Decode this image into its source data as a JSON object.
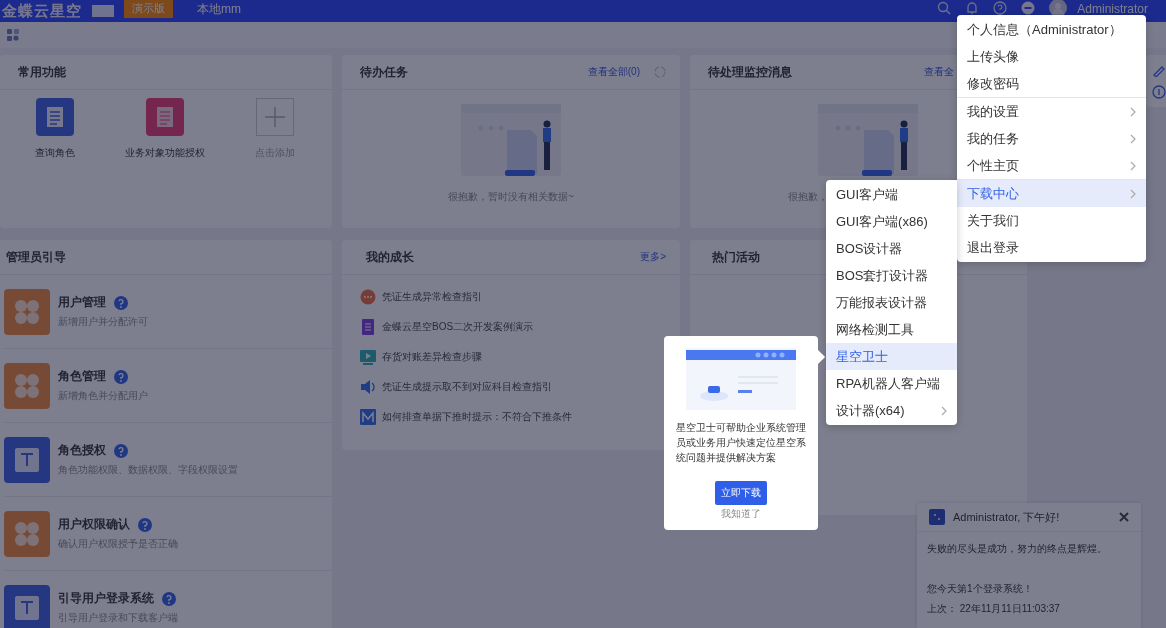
{
  "header": {
    "logo": "金蝶云星空",
    "demo_badge": "演示版",
    "org": "本地mm",
    "user": "Administrator"
  },
  "common_functions": {
    "title": "常用功能",
    "items": [
      {
        "label": "查询角色",
        "kind": "list"
      },
      {
        "label": "业务对象功能授权",
        "kind": "doc"
      },
      {
        "label": "点击添加",
        "kind": "add"
      }
    ]
  },
  "todo": {
    "title": "待办任务",
    "link": "查看全部(0)",
    "empty": "很抱歉，暂时没有相关数据~"
  },
  "monitor": {
    "title": "待处理监控消息",
    "link": "查看全",
    "empty": "很抱歉，"
  },
  "admin_guide": {
    "title": "管理员引导",
    "items": [
      {
        "title": "用户管理",
        "desc": "新增用户并分配许可",
        "kind": "clover"
      },
      {
        "title": "角色管理",
        "desc": "新增角色并分配用户",
        "kind": "clover"
      },
      {
        "title": "角色授权",
        "desc": "角色功能权限、数据权限、字段权限设置",
        "kind": "text"
      },
      {
        "title": "用户权限确认",
        "desc": "确认用户权限授予是否正确",
        "kind": "clover"
      },
      {
        "title": "引导用户登录系统",
        "desc": "引导用户登录和下载客户端",
        "kind": "text"
      }
    ]
  },
  "growth": {
    "title": "我的成长",
    "link": "更多>",
    "items": [
      {
        "text": "凭证生成异常检查指引",
        "kind": "chat"
      },
      {
        "text": "金蝶云星空BOS二次开发案例演示",
        "kind": "doc"
      },
      {
        "text": "存货对账差异检查步骤",
        "kind": "video"
      },
      {
        "text": "凭证生成提示取不到对应科目检查指引",
        "kind": "audio"
      },
      {
        "text": "如何排查单据下推时提示：不符合下推条件",
        "kind": "chart"
      }
    ]
  },
  "hot": {
    "title": "热门活动"
  },
  "user_menu": {
    "items": [
      {
        "label": "个人信息（Administrator）",
        "submenu": false,
        "selected": false,
        "divider_after": false
      },
      {
        "label": "上传头像",
        "submenu": false,
        "selected": false,
        "divider_after": false
      },
      {
        "label": "修改密码",
        "submenu": false,
        "selected": false,
        "divider_after": true
      },
      {
        "label": "我的设置",
        "submenu": true,
        "selected": false,
        "divider_after": false
      },
      {
        "label": "我的任务",
        "submenu": true,
        "selected": false,
        "divider_after": false
      },
      {
        "label": "个性主页",
        "submenu": true,
        "selected": false,
        "divider_after": true
      },
      {
        "label": "下载中心",
        "submenu": true,
        "selected": true,
        "divider_after": false
      },
      {
        "label": "关于我们",
        "submenu": false,
        "selected": false,
        "divider_after": false
      },
      {
        "label": "退出登录",
        "submenu": false,
        "selected": false,
        "divider_after": false
      }
    ]
  },
  "download_menu": {
    "items": [
      {
        "label": "GUI客户端",
        "submenu": false,
        "selected": false
      },
      {
        "label": "GUI客户端(x86)",
        "submenu": false,
        "selected": false
      },
      {
        "label": "BOS设计器",
        "submenu": false,
        "selected": false
      },
      {
        "label": "BOS套打设计器",
        "submenu": false,
        "selected": false
      },
      {
        "label": "万能报表设计器",
        "submenu": false,
        "selected": false
      },
      {
        "label": "网络检测工具",
        "submenu": false,
        "selected": false
      },
      {
        "label": "星空卫士",
        "submenu": false,
        "selected": true
      },
      {
        "label": "RPA机器人客户端",
        "submenu": false,
        "selected": false
      },
      {
        "label": "设计器(x64)",
        "submenu": true,
        "selected": false
      }
    ]
  },
  "popover": {
    "text": "星空卫士可帮助企业系统管理员或业务用户快速定位星空系统问题并提供解决方案",
    "button": "立即下载",
    "dismiss": "我知道了"
  },
  "greeting": {
    "title": "Administrator, 下午好!",
    "quote": "失败的尽头是成功，努力的终点是辉煌。",
    "count": "您今天第1个登录系统！",
    "last_login": "上次： 22年11月11日11:03:37"
  }
}
